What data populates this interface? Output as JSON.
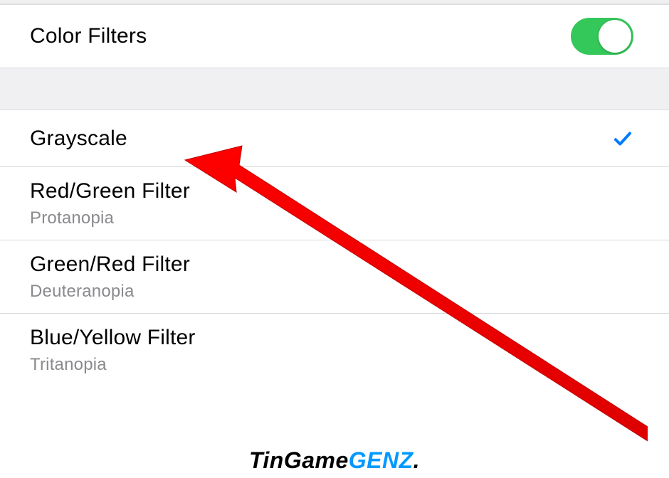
{
  "header": {
    "toggle_label": "Color Filters",
    "toggle_on": true
  },
  "filters": [
    {
      "title": "Grayscale",
      "subtitle": "",
      "selected": true
    },
    {
      "title": "Red/Green Filter",
      "subtitle": "Protanopia",
      "selected": false
    },
    {
      "title": "Green/Red Filter",
      "subtitle": "Deuteranopia",
      "selected": false
    },
    {
      "title": "Blue/Yellow Filter",
      "subtitle": "Tritanopia",
      "selected": false
    }
  ],
  "colors": {
    "toggle_on": "#34c759",
    "checkmark": "#007aff",
    "arrow": "#ff0000"
  },
  "watermark": {
    "part1": "TinGame",
    "part2": "GENZ",
    "part3": "."
  }
}
